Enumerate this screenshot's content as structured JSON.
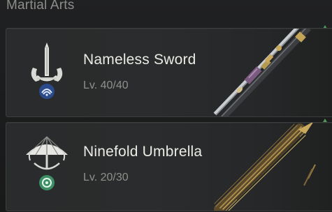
{
  "section": {
    "title": "Martial Arts"
  },
  "weapons": [
    {
      "name": "Nameless Sword",
      "level": "Lv. 40/40",
      "icon": "sword-skill-icon",
      "art": "sword-art"
    },
    {
      "name": "Ninefold Umbrella",
      "level": "Lv. 20/30",
      "icon": "umbrella-skill-icon",
      "art": "umbrella-art"
    }
  ],
  "colors": {
    "accent_green": "#4f9a5a",
    "text_primary": "#ebebe6",
    "text_secondary": "#8f8f8b"
  }
}
